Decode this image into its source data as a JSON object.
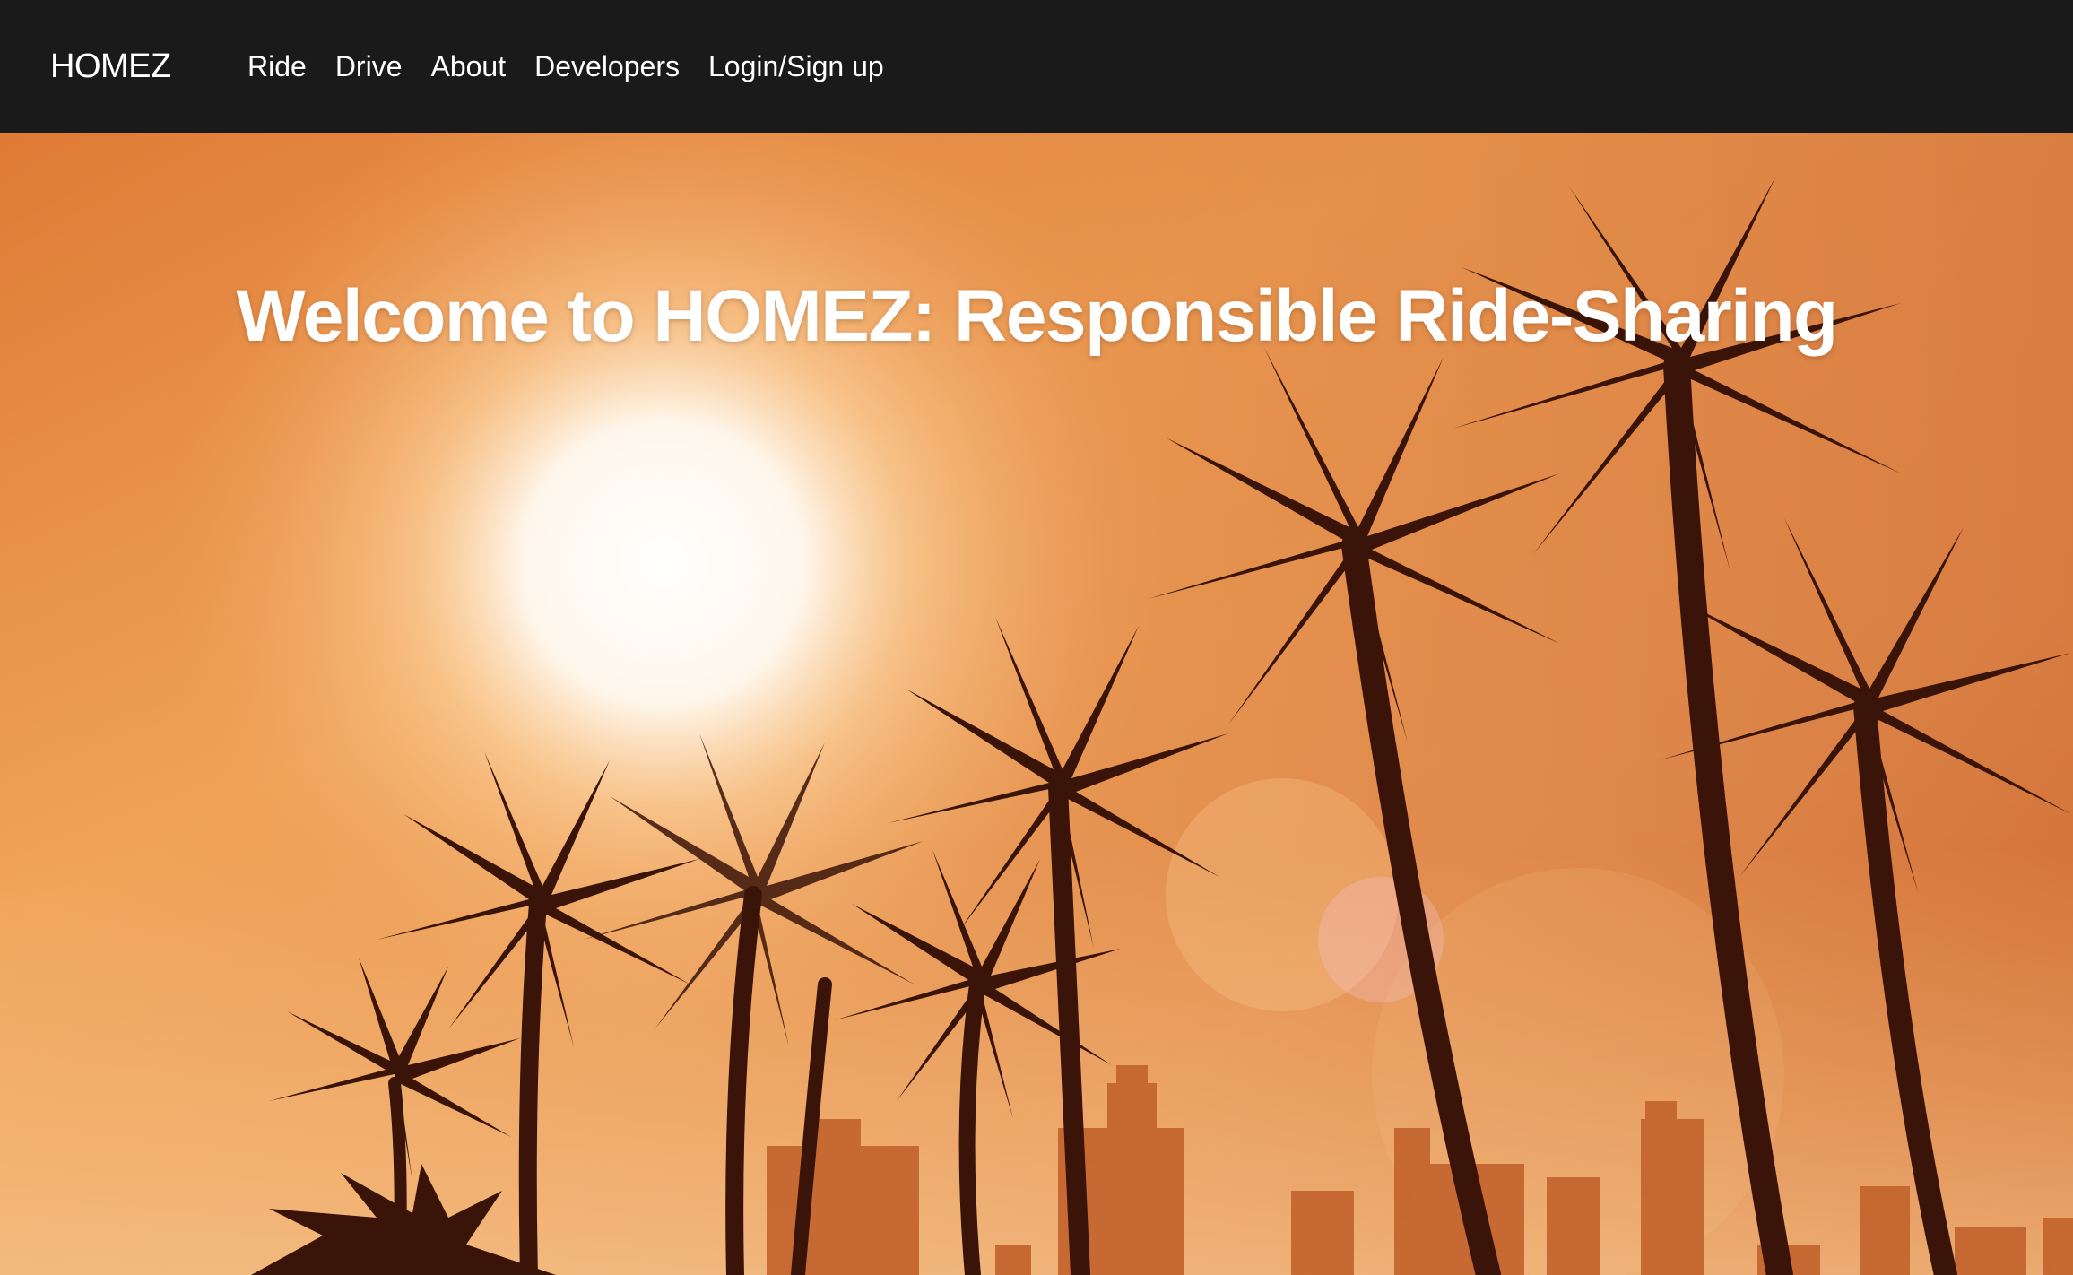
{
  "brand": "HOMEZ",
  "nav": {
    "items": [
      {
        "label": "Ride"
      },
      {
        "label": "Drive"
      },
      {
        "label": "About"
      },
      {
        "label": "Developers"
      },
      {
        "label": "Login/Sign up"
      }
    ]
  },
  "hero": {
    "title": "Welcome to HOMEZ: Responsible Ride-Sharing",
    "image": "sunset-palm-trees-city-skyline"
  },
  "colors": {
    "navbar_bg": "#1a1a1a",
    "nav_text": "#ffffff",
    "sky_orange": "#e8893a",
    "silhouette": "#3a1408"
  }
}
